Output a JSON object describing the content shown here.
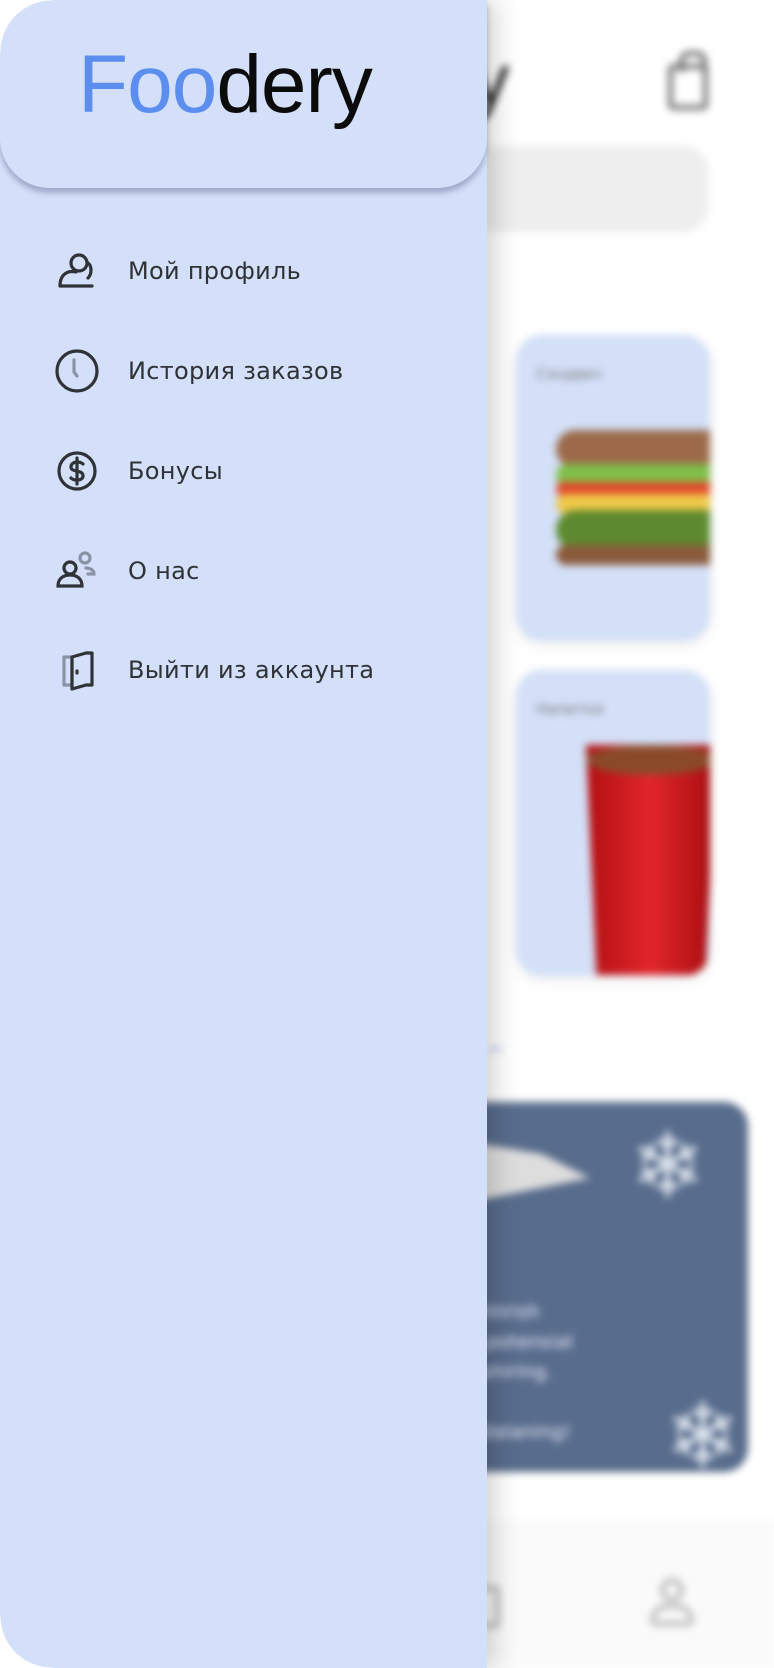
{
  "app": {
    "logo_part1": "Foo",
    "logo_part2": "dery"
  },
  "menu": {
    "items": [
      {
        "label": "Мой профиль",
        "icon": "profile-icon"
      },
      {
        "label": "История заказов",
        "icon": "clock-icon"
      },
      {
        "label": "Бонусы",
        "icon": "dollar-coin-icon"
      },
      {
        "label": "О нас",
        "icon": "users-icon"
      },
      {
        "label": "Выйти из аккаунта",
        "icon": "logout-door-icon"
      }
    ]
  },
  "background": {
    "title_fragment": "y",
    "cards": [
      {
        "label": "Сэндвич"
      },
      {
        "label": "Напитки"
      }
    ],
    "banner_text": "shtirish\ns potensial\noshiring.\n\nydalaning!"
  },
  "colors": {
    "drawer_bg": "#d4e0fa",
    "logo_accent": "#5c8ef0",
    "text": "#2f3236",
    "banner": "#586c8c"
  }
}
